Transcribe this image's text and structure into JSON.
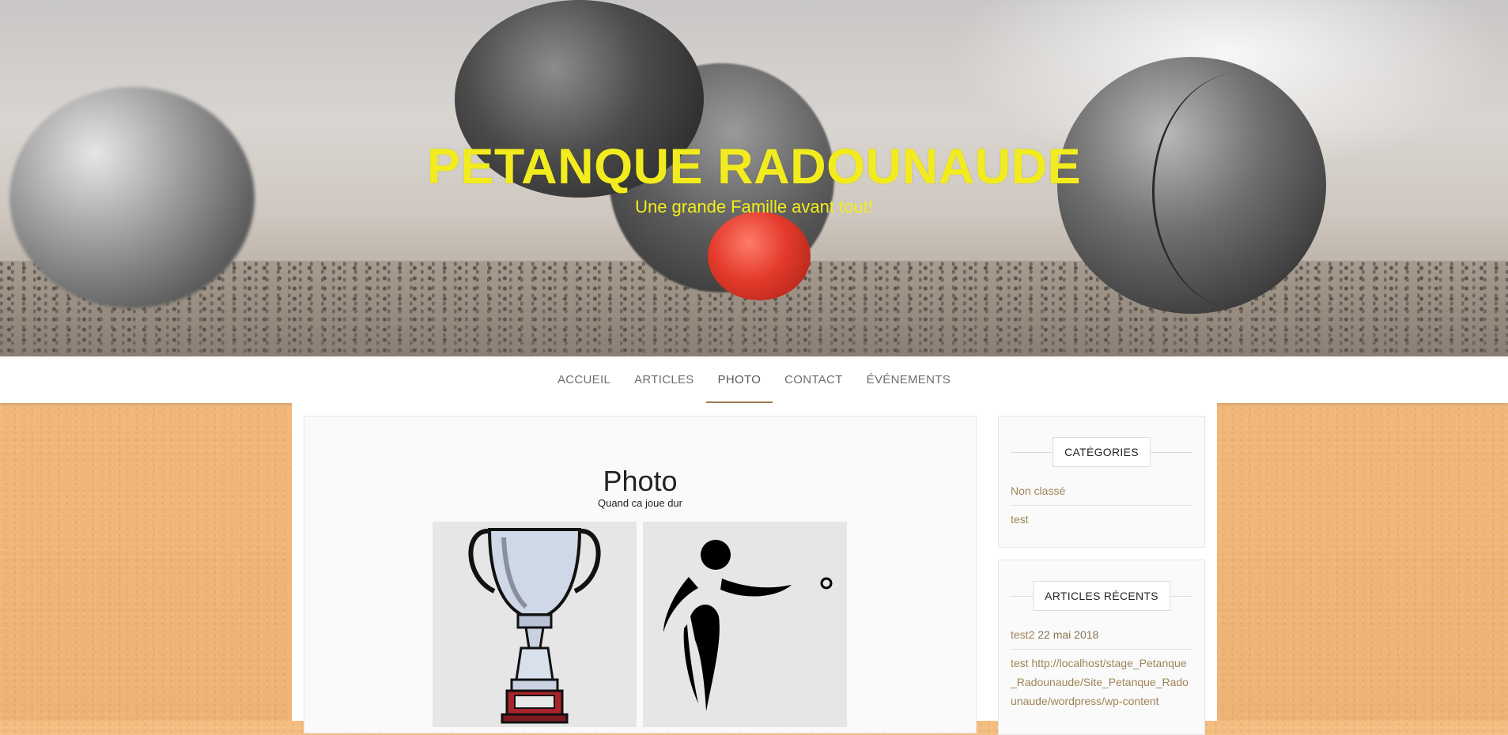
{
  "site": {
    "title": "PETANQUE RADOUNAUDE",
    "tagline": "Une grande Famille avant tout!"
  },
  "nav": {
    "items": [
      "ACCUEIL",
      "ARTICLES",
      "PHOTO",
      "CONTACT",
      "ÉVÉNEMENTS"
    ],
    "active": "PHOTO"
  },
  "page": {
    "title": "Photo",
    "caption": "Quand ca joue dur",
    "gallery": [
      "trophy-image",
      "petanque-player-image"
    ]
  },
  "sidebar": {
    "categories": {
      "title": "CATÉGORIES",
      "items": [
        "Non classé",
        "test"
      ]
    },
    "recent": {
      "title": "ARTICLES RÉCENTS",
      "items": [
        {
          "title": "test2",
          "date": "22 mai 2018"
        },
        {
          "title": "test http://localhost/stage_Petanque_Radounaude/Site_Petanque_Radounaude/wordpress/wp-content"
        }
      ]
    }
  },
  "colors": {
    "title": "#f2ec1e",
    "accent": "#9b7b4c",
    "link": "#a08458",
    "background_sand": "#f2b878"
  }
}
